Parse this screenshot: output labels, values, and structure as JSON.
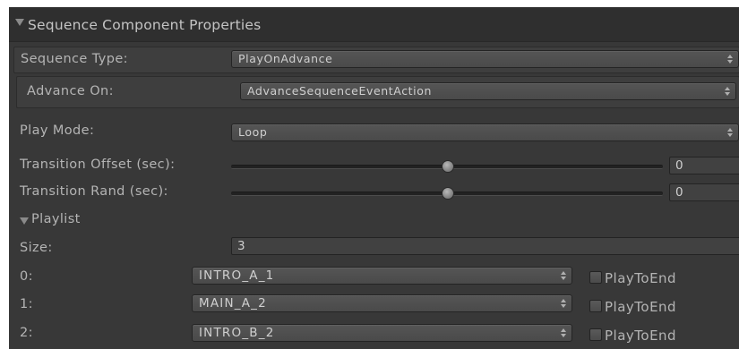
{
  "header": {
    "title": "Sequence Component Properties"
  },
  "sequence_type": {
    "label": "Sequence Type:",
    "value": "PlayOnAdvance"
  },
  "advance_on": {
    "label": "Advance On:",
    "value": "AdvanceSequenceEventAction"
  },
  "play_mode": {
    "label": "Play Mode:",
    "value": "Loop"
  },
  "transition_offset": {
    "label": "Transition Offset (sec):",
    "value": "0"
  },
  "transition_rand": {
    "label": "Transition Rand (sec):",
    "value": "0"
  },
  "playlist": {
    "label": "Playlist",
    "size_label": "Size:",
    "size_value": "3",
    "items": [
      {
        "index": "0:",
        "value": "INTRO_A_1",
        "checkbox_label": "PlayToEnd"
      },
      {
        "index": "1:",
        "value": "MAIN_A_2",
        "checkbox_label": "PlayToEnd"
      },
      {
        "index": "2:",
        "value": "INTRO_B_2",
        "checkbox_label": "PlayToEnd"
      }
    ]
  }
}
